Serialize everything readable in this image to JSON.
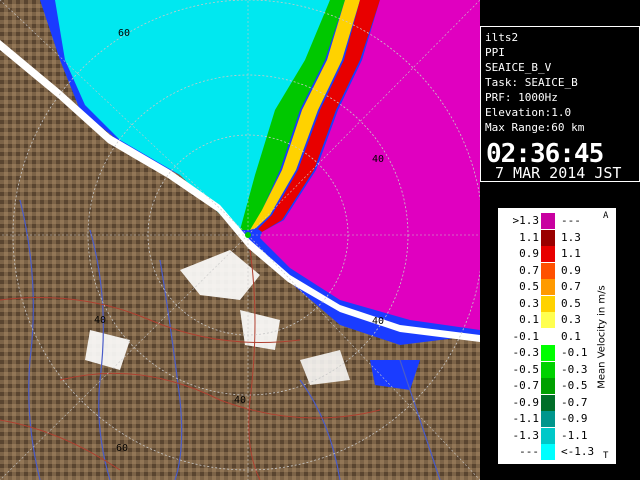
{
  "info": {
    "lines": [
      "ilts2",
      "PPI",
      "SEAICE_B_V",
      "Task: SEAICE_B",
      "PRF: 1000Hz",
      "Elevation:1.0",
      "Max Range:60 km"
    ],
    "time": "02:36:45",
    "date": "7 MAR 2014 JST"
  },
  "range_labels": [
    {
      "text": "60",
      "pos": "top-left"
    },
    {
      "text": "40",
      "pos": "upper-right"
    },
    {
      "text": "40",
      "pos": "left"
    },
    {
      "text": "40",
      "pos": "right"
    },
    {
      "text": "40",
      "pos": "bottom"
    },
    {
      "text": "60",
      "pos": "bottom-left"
    }
  ],
  "legend": {
    "title": "Mean Velocity in m/s",
    "mark_top": "A",
    "mark_bottom": "T",
    "rows": [
      {
        "left": ">1.3",
        "right": "---",
        "color": "#c800a0"
      },
      {
        "left": "1.1",
        "right": "1.3",
        "color": "#9a0000"
      },
      {
        "left": "0.9",
        "right": "1.1",
        "color": "#e80000"
      },
      {
        "left": "0.7",
        "right": "0.9",
        "color": "#ff5000"
      },
      {
        "left": "0.5",
        "right": "0.7",
        "color": "#ff9a00"
      },
      {
        "left": "0.3",
        "right": "0.5",
        "color": "#ffd200"
      },
      {
        "left": "0.1",
        "right": "0.3",
        "color": "#ffff50"
      },
      {
        "left": "-0.1",
        "right": "0.1",
        "color": "#ffffff"
      },
      {
        "left": "-0.3",
        "right": "-0.1",
        "color": "#00ff00"
      },
      {
        "left": "-0.5",
        "right": "-0.3",
        "color": "#00d200"
      },
      {
        "left": "-0.7",
        "right": "-0.5",
        "color": "#00a000"
      },
      {
        "left": "-0.9",
        "right": "-0.7",
        "color": "#006e28"
      },
      {
        "left": "-1.1",
        "right": "-0.9",
        "color": "#00968c"
      },
      {
        "left": "-1.3",
        "right": "-1.1",
        "color": "#00c8c8"
      },
      {
        "left": "---",
        "right": "<-1.3",
        "color": "#00ffff"
      }
    ]
  },
  "colors": {
    "land": "#7c6347",
    "land_dark": "#5a4530",
    "sea_far": "#1a3cff",
    "sea_near": "#00e8f0",
    "magenta": "#e000c0",
    "ring": "#c8c8c8",
    "river": "#4a5cc8",
    "road": "#b04030"
  }
}
